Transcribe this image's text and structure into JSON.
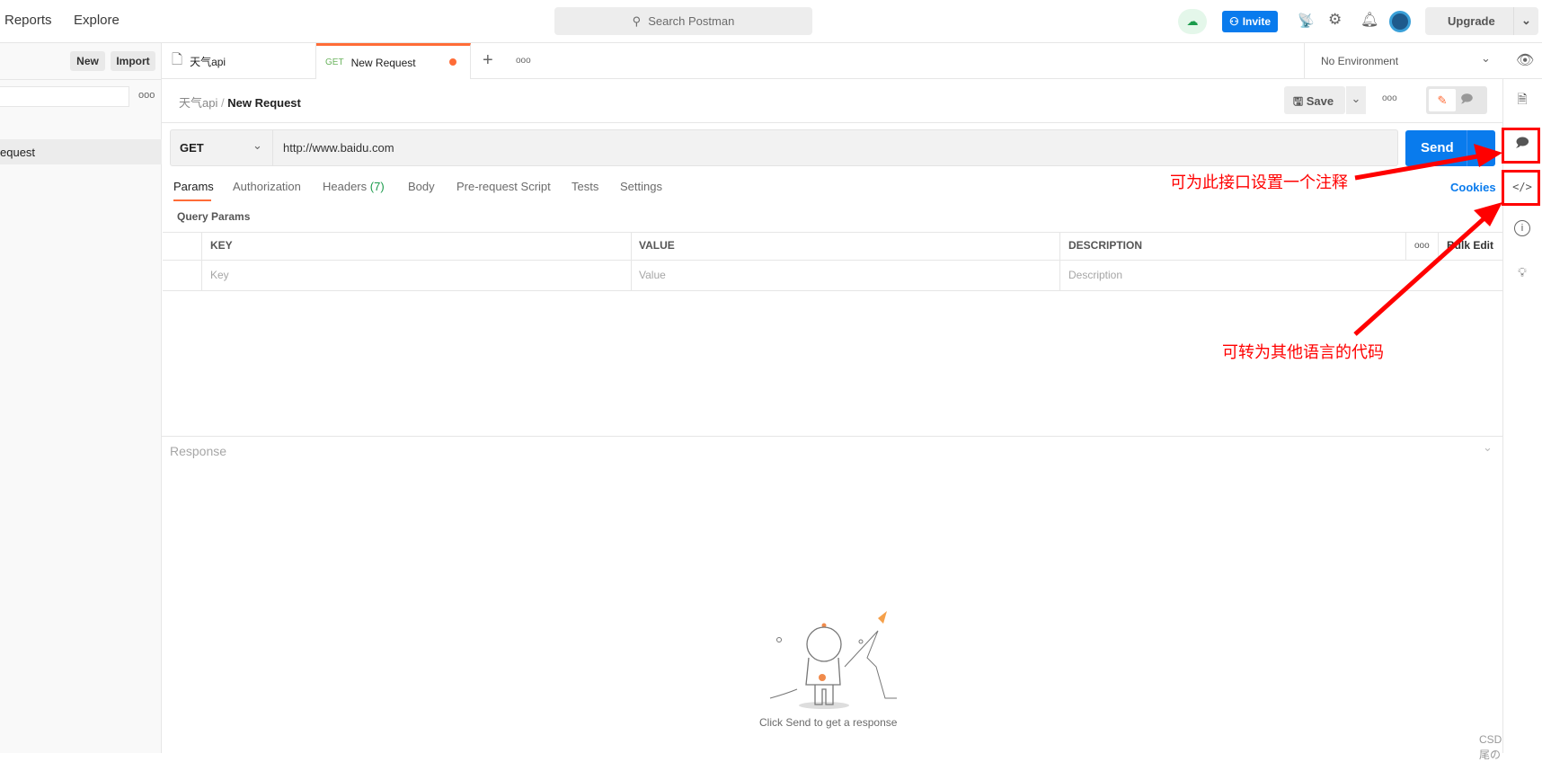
{
  "topbar": {
    "nav": [
      "Reports",
      "Explore"
    ],
    "search_placeholder": "Search Postman",
    "invite_label": "Invite",
    "upgrade_label": "Upgrade"
  },
  "sidebar": {
    "new_label": "New",
    "import_label": "Import",
    "selected_item": "equest"
  },
  "tabs": [
    {
      "label": "天气api"
    },
    {
      "method": "GET",
      "label": "New Request",
      "unsaved": true
    }
  ],
  "environment": {
    "selected": "No Environment"
  },
  "breadcrumb": {
    "parent": "天气api",
    "separator": "/",
    "current": "New Request"
  },
  "actions": {
    "save_label": "Save"
  },
  "request": {
    "method": "GET",
    "url": "http://www.baidu.com",
    "send_label": "Send"
  },
  "request_tabs": [
    {
      "label": "Params",
      "active": true
    },
    {
      "label": "Authorization"
    },
    {
      "label": "Headers",
      "count": "(7)"
    },
    {
      "label": "Body"
    },
    {
      "label": "Pre-request Script"
    },
    {
      "label": "Tests"
    },
    {
      "label": "Settings"
    }
  ],
  "cookies_label": "Cookies",
  "params": {
    "title": "Query Params",
    "headers": [
      "KEY",
      "VALUE",
      "DESCRIPTION"
    ],
    "bulk_edit": "Bulk Edit",
    "placeholders": [
      "Key",
      "Value",
      "Description"
    ]
  },
  "response": {
    "title": "Response",
    "empty_message": "Click Send to get a response"
  },
  "annotations": [
    "可为此接口设置一个注释",
    "可转为其他语言的代码"
  ],
  "watermark": "CSDN @雪尾の",
  "colors": {
    "accent": "#ff6c37",
    "send": "#097bed",
    "annotation": "#ff0000"
  }
}
